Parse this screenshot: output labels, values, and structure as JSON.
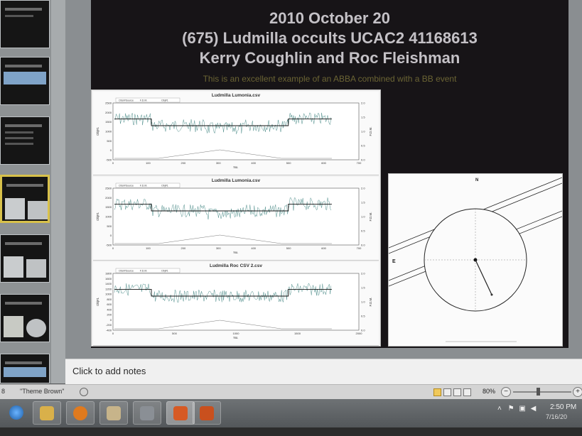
{
  "slide": {
    "title_lines": [
      "2010 October 20",
      "(675) Ludmilla occults UCAC2 41168613",
      "Kerry Coughlin and Roc Fleishman"
    ],
    "subtitle": "This is an excellent example of an ABBA combined with a BB event"
  },
  "plots": [
    {
      "title": "Ludmilla Lumonia.csv",
      "legend": [
        "Obs#/Source",
        "F.D.M.",
        "Obj#1"
      ],
      "xticks": [
        "0",
        "100",
        "200",
        "300",
        "400",
        "500",
        "600",
        "700"
      ],
      "yticks": [
        "2500",
        "2000",
        "1500",
        "1000",
        "500",
        "0",
        "-500"
      ],
      "y2ticks": [
        "2.0",
        "1.5",
        "1.0",
        "0.5",
        "0.0"
      ],
      "xlabel": "No.",
      "ylabel": "Obj#1",
      "y2label": "F.D.M."
    },
    {
      "title": "Ludmilla Lumonia.csv",
      "legend": [
        "Obs#/Source",
        "F.D.M.",
        "Obj#1"
      ],
      "xticks": [
        "0",
        "100",
        "200",
        "300",
        "400",
        "500",
        "600",
        "700"
      ],
      "yticks": [
        "2500",
        "2000",
        "1500",
        "1000",
        "500",
        "0",
        "-500"
      ],
      "y2ticks": [
        "2.0",
        "1.5",
        "1.0",
        "0.5",
        "0.0"
      ],
      "xlabel": "No.",
      "ylabel": "Obj#1",
      "y2label": "F.D.M."
    },
    {
      "title": "Ludmilla Roc CSV 2.csv",
      "legend": [
        "Obs#/Source",
        "F.D.M.",
        "Obj#1"
      ],
      "xticks": [
        "0",
        "500",
        "1000",
        "1500",
        "2000"
      ],
      "yticks": [
        "1800",
        "1600",
        "1400",
        "1200",
        "1000",
        "800",
        "600",
        "400",
        "200",
        "0",
        "-200",
        "-400"
      ],
      "y2ticks": [
        "2.0",
        "1.5",
        "1.0",
        "0.5",
        "0.0"
      ],
      "xlabel": "No.",
      "ylabel": "Obj#1",
      "y2label": "F.D.M."
    }
  ],
  "circle_panel": {
    "east": "E",
    "north": "N"
  },
  "notes": {
    "placeholder": "Click to add notes"
  },
  "status": {
    "slide_info": "8",
    "theme": "\"Theme Brown\"",
    "zoom": "80%",
    "zoom_out": "−",
    "zoom_in": "+"
  },
  "taskbar": {
    "apps": [
      {
        "name": "internet-explorer",
        "color": "#2f7fd0"
      },
      {
        "name": "file-explorer",
        "color": "#d9b04a"
      },
      {
        "name": "media-player",
        "color": "#e07a1e"
      },
      {
        "name": "app-4",
        "color": "#c7b48a"
      },
      {
        "name": "app-5",
        "color": "#8a8f95"
      },
      {
        "name": "powerpoint",
        "color": "#d65a24"
      },
      {
        "name": "app-7",
        "color": "#c9501e"
      }
    ],
    "clock_time": "2:50 PM",
    "clock_date": "7/16/20"
  }
}
